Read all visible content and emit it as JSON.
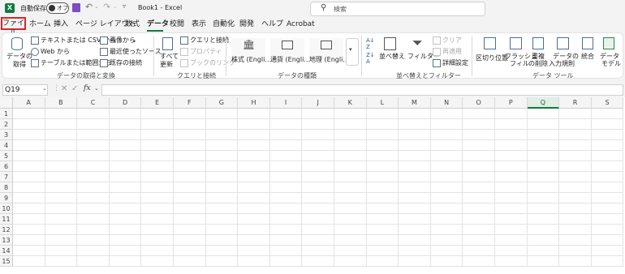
{
  "titlebar": {
    "autosave_label": "自動保存",
    "toggle_state": "オフ",
    "doc_title": "Book1  -  Excel",
    "search_placeholder": "検索"
  },
  "menu": {
    "tabs": [
      "ファイル",
      "ホーム",
      "挿入",
      "ページ レイアウト",
      "数式",
      "データ",
      "校閲",
      "表示",
      "自動化",
      "開発",
      "ヘルプ",
      "Acrobat"
    ],
    "active": "データ"
  },
  "ribbon": {
    "get_data": {
      "btn_get_data": "データの\n取得",
      "from_text_csv": "テキストまたは CSV から",
      "from_web": "Web から",
      "from_table": "テーブルまたは範囲から",
      "from_image": "画像から",
      "recent_sources": "最近使ったソース",
      "existing_connections": "既存の接続",
      "group_label": "データの取得と変換"
    },
    "queries": {
      "refresh_all": "すべて\n更新",
      "queries_connections": "クエリと接続",
      "properties": "プロパティ",
      "workbook_links": "ブックのリンク",
      "group_label": "クエリと接続"
    },
    "data_types": {
      "stocks": "株式 (Engli…",
      "currency": "通貨 (Engli…",
      "geography": "地理 (Engli…",
      "group_label": "データの種類"
    },
    "sort_filter": {
      "sort": "並べ替え",
      "filter": "フィルター",
      "clear": "クリア",
      "reapply": "再適用",
      "advanced": "詳細設定",
      "group_label": "並べ替えとフィルター"
    },
    "data_tools": {
      "text_to_columns": "区切り位置",
      "flash_fill_1": "フラッシュ",
      "flash_fill_2": "フィル",
      "remove_dup_1": "重複",
      "remove_dup_2": "の削除",
      "validation_1": "データの",
      "validation_2": "入力規則",
      "consolidate": "統合",
      "data_model_1": "データ",
      "data_model_2": "モデル",
      "group_label": "データ ツール"
    }
  },
  "formula_bar": {
    "name_box": "Q19",
    "fx": "fx",
    "value": ""
  },
  "grid": {
    "columns": [
      "A",
      "B",
      "C",
      "D",
      "E",
      "F",
      "G",
      "H",
      "I",
      "J",
      "K",
      "L",
      "M",
      "N",
      "O",
      "P",
      "Q",
      "R",
      "S"
    ],
    "rows": [
      "1",
      "2",
      "3",
      "4",
      "5",
      "6",
      "7",
      "8",
      "9",
      "10",
      "11",
      "12",
      "13",
      "14",
      "15"
    ],
    "selected_column": "Q"
  },
  "colors": {
    "excel_green": "#107c41",
    "file_tab_highlight": "#d6272d"
  }
}
